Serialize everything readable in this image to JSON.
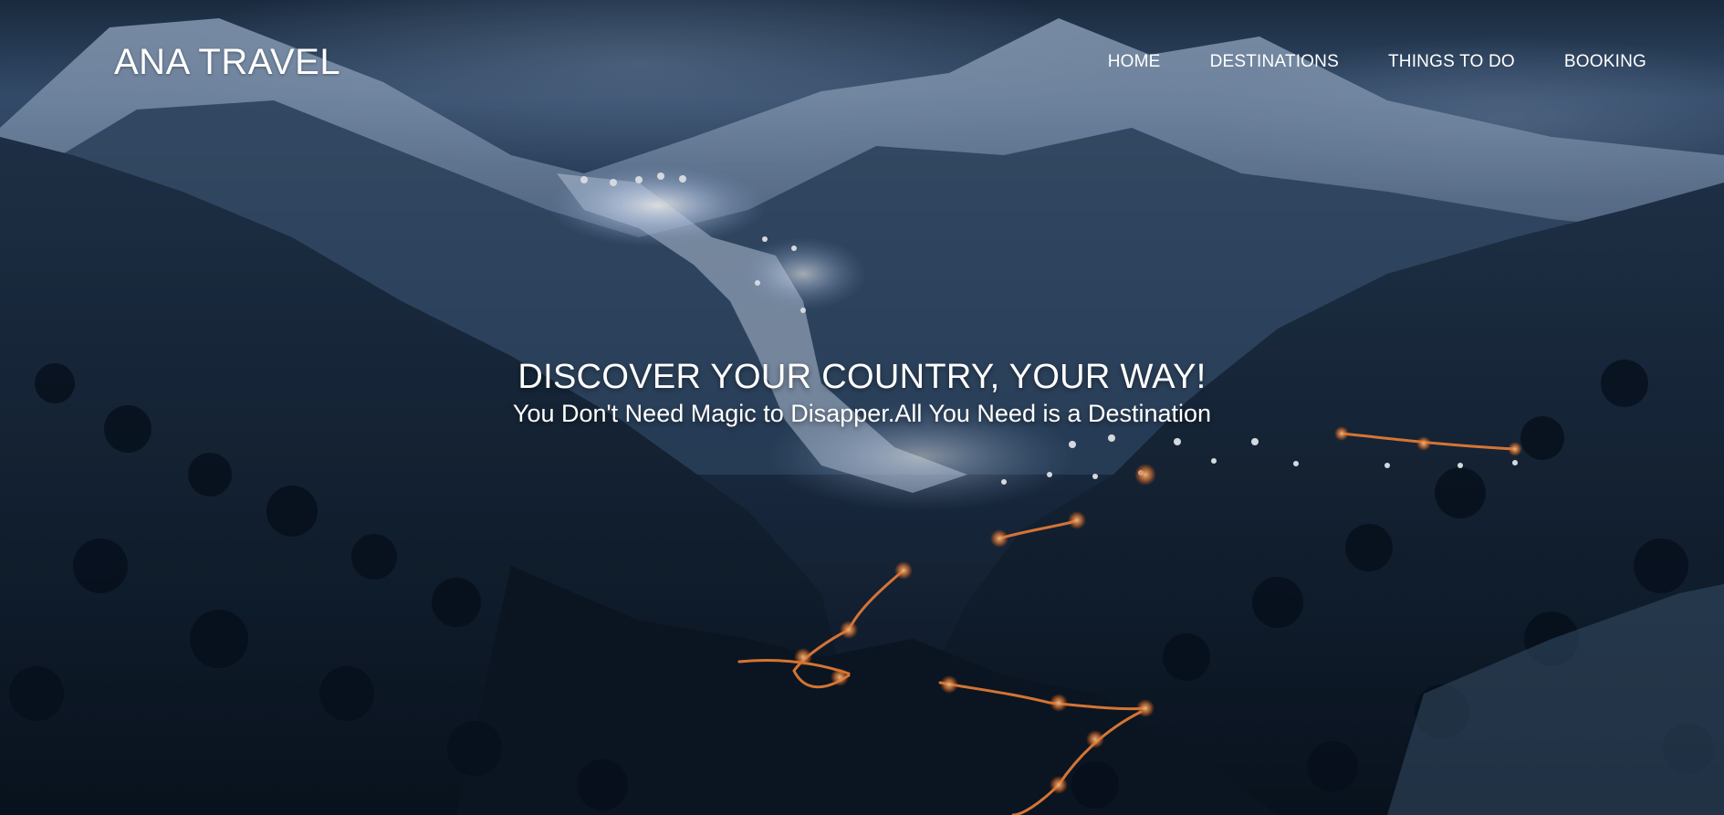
{
  "brand": {
    "name": "ANA TRAVEL"
  },
  "nav": {
    "items": [
      {
        "label": "HOME"
      },
      {
        "label": "DESTINATIONS"
      },
      {
        "label": "THINGS TO DO"
      },
      {
        "label": "BOOKING"
      }
    ]
  },
  "hero": {
    "title": "DISCOVER YOUR COUNTRY, YOUR WAY!",
    "subtitle": "You Don't Need Magic to Disapper.All You Need is a Destination",
    "image_icon": "night-mountain-valley-image"
  },
  "colors": {
    "text": "#ffffff",
    "sky": "#2c4566",
    "mountain_dark": "#0d1a29",
    "snow": "#8fa6c4",
    "lights_warm": "#ff8a3d",
    "lights_cool": "#eef4ff"
  }
}
